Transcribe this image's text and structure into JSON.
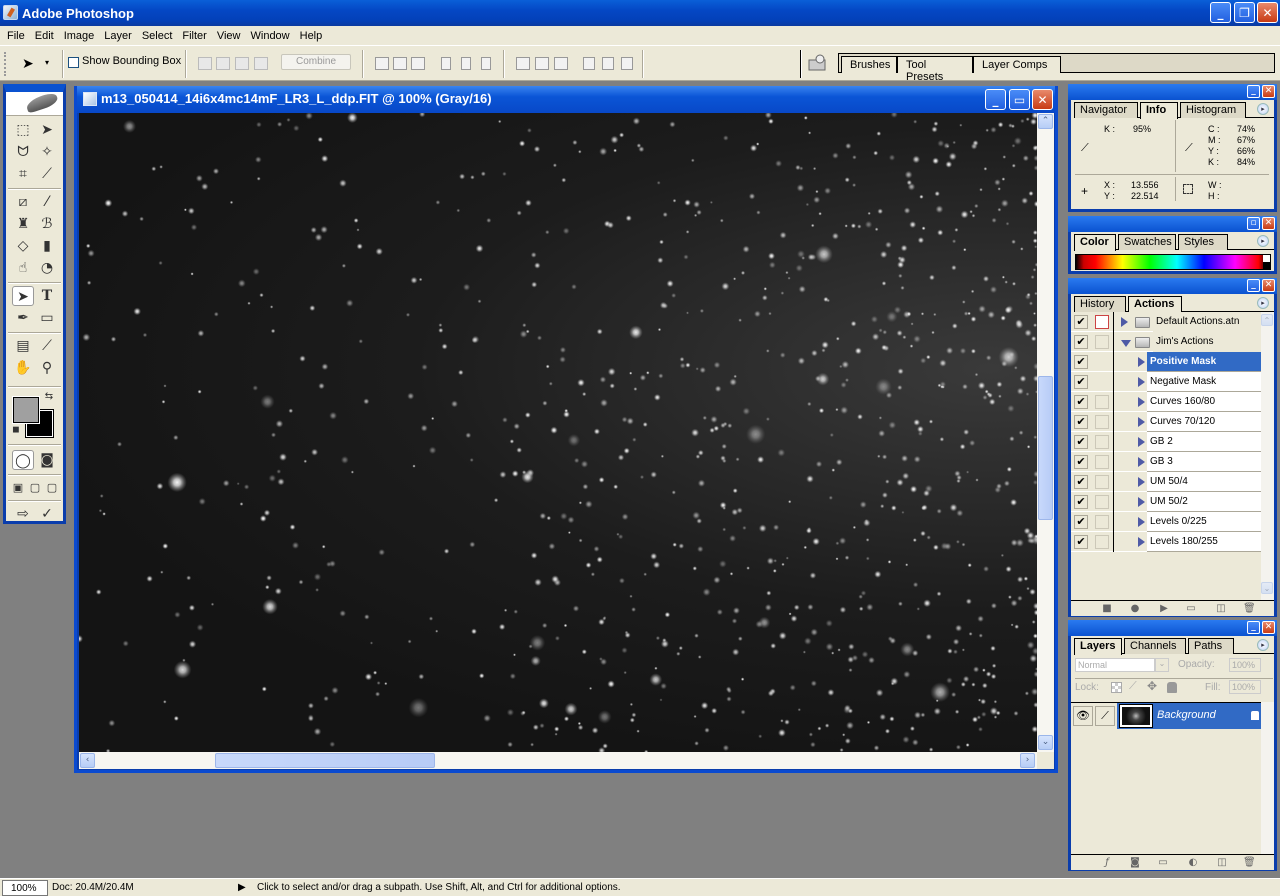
{
  "app": {
    "title": "Adobe Photoshop",
    "window_controls": {
      "minimize": "_",
      "restore": "❐",
      "close": "✕"
    }
  },
  "menu": [
    "File",
    "Edit",
    "Image",
    "Layer",
    "Select",
    "Filter",
    "View",
    "Window",
    "Help"
  ],
  "options_bar": {
    "tool_icon": "path-selection-arrow-icon",
    "show_bounding_box_label": "Show Bounding Box",
    "show_bounding_box_checked": false,
    "combine_label": "Combine",
    "path_ops": [
      "add-to-shape-icon",
      "subtract-from-shape-icon",
      "intersect-shape-icon",
      "exclude-overlap-icon"
    ],
    "align_icons": [
      "align-top-icon",
      "align-vcenter-icon",
      "align-bottom-icon",
      "align-left-icon",
      "align-hcenter-icon",
      "align-right-icon"
    ],
    "distribute_icons": [
      "distribute-top-icon",
      "distribute-vcenter-icon",
      "distribute-bottom-icon",
      "distribute-left-icon",
      "distribute-hcenter-icon",
      "distribute-right-icon"
    ],
    "palette_well_tabs": [
      "Brushes",
      "Tool Presets",
      "Layer Comps"
    ]
  },
  "toolbox": {
    "tools": [
      "marquee",
      "move",
      "lasso",
      "magic-wand",
      "crop",
      "slice",
      "healing-brush",
      "brush",
      "clone-stamp",
      "history-brush",
      "eraser",
      "gradient",
      "blur",
      "dodge",
      "path-selection",
      "type",
      "pen",
      "rectangle",
      "notes",
      "eyedropper",
      "hand",
      "zoom"
    ],
    "selected_tool": "path-selection",
    "foreground_color": "#a0a0a0",
    "background_color": "#000000"
  },
  "document": {
    "title": "m13_050414_14i6x4mc14mF_LR3_L_ddp.FIT @ 100% (Gray/16)",
    "description": "Star field (globular cluster M13), grayscale astro image"
  },
  "info_panel": {
    "tabs": [
      "Navigator",
      "Info",
      "Histogram"
    ],
    "active_tab": "Info",
    "left_readout": {
      "K": "95%"
    },
    "right_readout": {
      "C": "74%",
      "M": "67%",
      "Y": "66%",
      "K": "84%"
    },
    "position": {
      "X": "13.556",
      "Y": "22.514"
    },
    "size": {
      "W": "",
      "H": ""
    }
  },
  "color_panel": {
    "tabs": [
      "Color",
      "Swatches",
      "Styles"
    ],
    "active_tab": "Color"
  },
  "actions_panel": {
    "tabs": [
      "History",
      "Actions"
    ],
    "active_tab": "Actions",
    "rows": [
      {
        "label": "Default Actions.atn",
        "type": "set",
        "expanded": false,
        "checked": true,
        "dialog": "red",
        "selected": false
      },
      {
        "label": "Jim's Actions",
        "type": "set",
        "expanded": true,
        "checked": true,
        "dialog": "empty",
        "selected": false
      },
      {
        "label": "Positive Mask",
        "type": "action",
        "checked": true,
        "dialog": "none",
        "selected": true
      },
      {
        "label": "Negative Mask",
        "type": "action",
        "checked": true,
        "dialog": "none",
        "selected": false
      },
      {
        "label": "Curves 160/80",
        "type": "action",
        "checked": true,
        "dialog": "empty",
        "selected": false
      },
      {
        "label": "Curves 70/120",
        "type": "action",
        "checked": true,
        "dialog": "empty",
        "selected": false
      },
      {
        "label": "GB 2",
        "type": "action",
        "checked": true,
        "dialog": "empty",
        "selected": false
      },
      {
        "label": "GB 3",
        "type": "action",
        "checked": true,
        "dialog": "empty",
        "selected": false
      },
      {
        "label": "UM 50/4",
        "type": "action",
        "checked": true,
        "dialog": "empty",
        "selected": false
      },
      {
        "label": "UM 50/2",
        "type": "action",
        "checked": true,
        "dialog": "empty",
        "selected": false
      },
      {
        "label": "Levels 0/225",
        "type": "action",
        "checked": true,
        "dialog": "empty",
        "selected": false
      },
      {
        "label": "Levels 180/255",
        "type": "action",
        "checked": true,
        "dialog": "empty",
        "selected": false
      }
    ],
    "footer_icons": [
      "stop-icon",
      "record-icon",
      "play-icon",
      "new-set-icon",
      "new-action-icon",
      "trash-icon"
    ]
  },
  "layers_panel": {
    "tabs": [
      "Layers",
      "Channels",
      "Paths"
    ],
    "active_tab": "Layers",
    "blend_mode": "Normal",
    "opacity_label": "Opacity:",
    "opacity": "100%",
    "lock_label": "Lock:",
    "fill_label": "Fill:",
    "fill": "100%",
    "layers": [
      {
        "name": "Background",
        "visible": true,
        "locked": true,
        "selected": true
      }
    ],
    "footer_icons": [
      "layer-style-icon",
      "mask-icon",
      "new-group-icon",
      "adjustment-layer-icon",
      "new-layer-icon",
      "trash-icon"
    ]
  },
  "status_bar": {
    "zoom": "100%",
    "doc_size": "Doc: 20.4M/20.4M",
    "hint": "Click to select and/or drag a subpath.  Use Shift, Alt, and Ctrl for additional options."
  },
  "info_labels": {
    "K": "K :",
    "C": "C :",
    "M": "M :",
    "Y": "Y :",
    "X": "X :",
    "Yp": "Y :",
    "W": "W :",
    "H": "H :"
  },
  "glyphs": {
    "check": "✔",
    "chev_up": "⌃",
    "chev_down": "⌄",
    "left": "‹",
    "right": "›",
    "menu": "▸",
    "dd": "▾",
    "lock": "🔒"
  }
}
